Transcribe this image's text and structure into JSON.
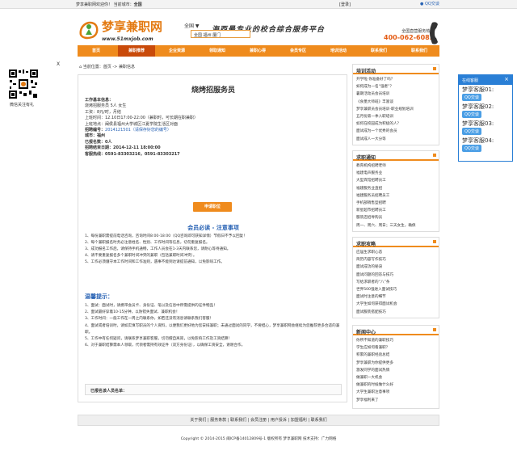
{
  "topbar": {
    "welcome": "梦享兼职网欢迎你！ 当前城市：",
    "city": "全国",
    "login": "[登录]",
    "qq": "QQ交谈"
  },
  "header": {
    "logo_name": "梦享兼职网",
    "logo_url": "www.51mxjob.com",
    "city_label": "全国 ▼",
    "city_dropdown": "全国  福州  厦门",
    "slogan": "海西最专业的校合综合服务平台",
    "hotline_label": "全国直营服务热线",
    "hotline": "400-062-6082"
  },
  "nav": [
    "首页",
    "兼职推荐",
    "企业资源",
    "领取通知",
    "兼职心得",
    "会员专区",
    "培训活动",
    "联系我们",
    "联系我们"
  ],
  "qr": {
    "close": "X",
    "caption": "微信关注有礼"
  },
  "float": {
    "title": "在线客服",
    "close": "×",
    "items": [
      {
        "name": "梦享客服01:",
        "btn": "QQ交谈"
      },
      {
        "name": "梦享客服02:",
        "btn": "QQ交谈"
      },
      {
        "name": "梦享客服03:",
        "btn": "QQ交谈"
      },
      {
        "name": "梦享客服04:",
        "btn": "QQ交谈"
      }
    ]
  },
  "breadcrumb": "当前位置：首页 -> 兼职信息",
  "job": {
    "title": "烧烤招服务员",
    "basic_label": "工作基本信息：",
    "row1": "烧烤招服务员          5人          女生",
    "salary": "工资：8元/时，月结",
    "time": "上班时间：12.10日17:00-22:00（兼职时，可长期在职兼职）",
    "place": "上班地点：闽侯县福州大学城区江夏学院生活区对面",
    "apply_label": "招聘编号：",
    "apply_value": "2014121501（请保存好您的编号）",
    "city": "城市：福州",
    "count": "已报名数：0人",
    "deadline": "招聘结束日期：2014-12-11 18:00:00",
    "hotline": "客服热线：0591-83303216，0591-83303217",
    "apply_btn": "申请职位"
  },
  "notice_title": "会员必读   -   注意事项",
  "rules": [
    "1、每份兼职需提前电话咨询，咨询时间8:00-18:00（QQ咨询即可获知详情）节假日不予以回复！",
    "2、每个兼职报名时务必注意姓名、性别、工作时间等信息，切勿重复报名。",
    "3、成功报名工作后，请保持手机通畅，工作人员会在1-3天内联系您，请耐心等待通知。",
    "4、请不要重复报名多个兼职时间冲突的兼职（包括兼职时间冲突）。",
    "5、工作必须遵守本工作时间和工作准则，遇事不能到达请提前通知，以免影响工作。"
  ],
  "tips_title": "温馨提示：",
  "tips": [
    "1、面试：面试时，请携带会员卡、身份证、笔以及信息中所需提供的证件物品！",
    "2、面试最好穿着10-15分钟，以防错失面试、兼职机会！",
    "3、工作时间：一般工作在一周之内联系你，如若还没有消息请联系我们客服！",
    "4、面试或者培训时，请如实填写职员的个人资料，以便我们更好地为您安排兼职；未通过面试的同学，不要担心，梦享兼职网会继续为您推荐更多合适的兼职。",
    "5、工作中有任何疑问，请联系梦享兼职客服，切勿擅自离岗，以免影响工作及工资结算！",
    "6、对于兼职结算需本人领取，代领者需持有效证件（双方身份证），以确保工资安全，谢谢合作。"
  ],
  "signed": "已报名该人员名单：",
  "sidebar": [
    {
      "title": "培训活动",
      "items": [
        "开学啦 你准备好了吗？",
        "如何成为一名“强者”？",
        "暑期活动员会员培训",
        "《食墨大师班》丰富谈",
        "梦享兼职员会员培训-职业规划培训",
        "五月份第一季入职培训",
        "如何在校园成为积极的人？",
        "面试成为一个优秀的会员",
        "面试成人一大分等"
      ]
    },
    {
      "title": "求职通知",
      "items": [
        "教育机构招聘老师",
        "福建电声服务业",
        "大型宾馆招聘员工",
        "福建服务业直招",
        "福建服务员招聘员工",
        "手机部销售型招聘",
        "新星超市招聘员工",
        "服装店招导购员",
        "周一、周六、周日；三天女生，确保"
      ]
    },
    {
      "title": "求职攻略",
      "items": [
        "应届生求职心态",
        "简历内容写作技巧",
        "面试成功的秘诀",
        "面试问题的回答与技巧",
        "写给求职者的“八”条",
        "世界500强进入面试技巧",
        "面试时注意的细节",
        "大学生如何获得面试机会",
        "面试服装搭配技巧"
      ]
    },
    {
      "title": "新闻中心",
      "items": [
        "你所不知道的兼职技巧",
        "学生应如何看兼职？",
        "积累的兼职经验总结",
        "梦享兼职为你提供更多",
        "激发同学的面试热情",
        "做兼职一大机会",
        "做兼职的时候做什么好",
        "大学生兼职注意事项",
        "梦享福利来了"
      ]
    }
  ],
  "footer": {
    "links": "关于我们 | 服务条款 | 联系我们 | 会员注册 | 用户投诉 | 加盟福利 | 联系我们",
    "copyright": "Copyright © 2014-2015 闽ICP备14012809号-1 版权所有 梦享兼职网 技术支持：广力网络"
  }
}
